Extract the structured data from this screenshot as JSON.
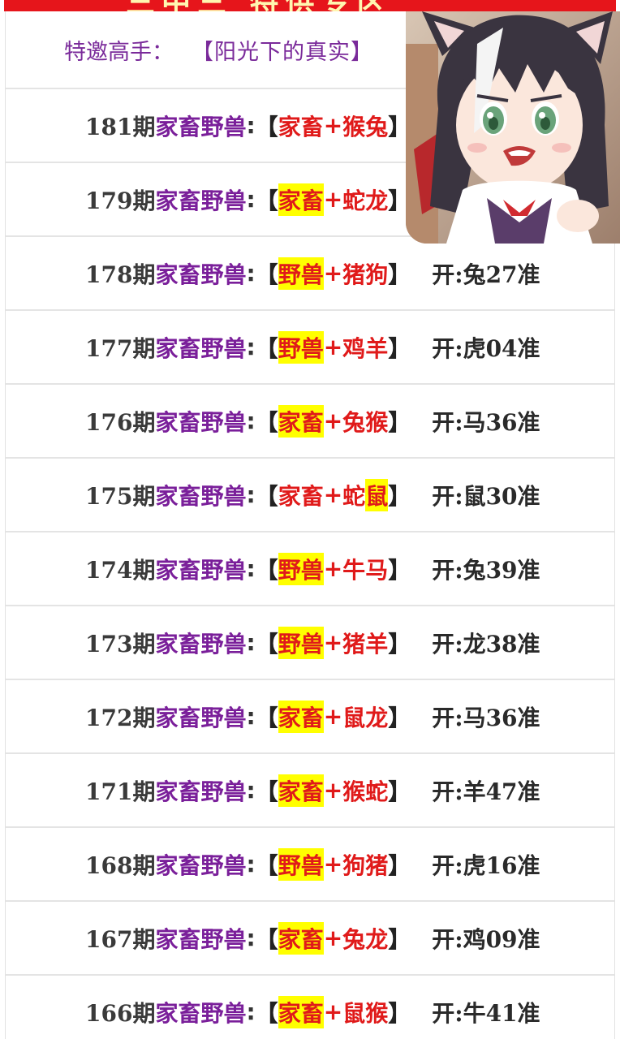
{
  "header": {
    "banner_text": "三中三    特供专区"
  },
  "guest": {
    "label": "特邀高手：",
    "name": "【阳光下的真实】"
  },
  "topic_label": "家畜野兽",
  "result_prefix": "开:",
  "result_suffix": "准",
  "rows": [
    {
      "issue": "181期",
      "group": "家畜",
      "group_hl": false,
      "animals": [
        {
          "t": "猴",
          "hl": false
        },
        {
          "t": "兔",
          "hl": false
        }
      ],
      "result": ""
    },
    {
      "issue": "179期",
      "group": "家畜",
      "group_hl": true,
      "animals": [
        {
          "t": "蛇",
          "hl": false
        },
        {
          "t": "龙",
          "hl": false
        }
      ],
      "result": ""
    },
    {
      "issue": "178期",
      "group": "野兽",
      "group_hl": true,
      "animals": [
        {
          "t": "猪",
          "hl": false
        },
        {
          "t": "狗",
          "hl": false
        }
      ],
      "result": "兔27"
    },
    {
      "issue": "177期",
      "group": "野兽",
      "group_hl": true,
      "animals": [
        {
          "t": "鸡",
          "hl": false
        },
        {
          "t": "羊",
          "hl": false
        }
      ],
      "result": "虎04"
    },
    {
      "issue": "176期",
      "group": "家畜",
      "group_hl": true,
      "animals": [
        {
          "t": "兔",
          "hl": false
        },
        {
          "t": "猴",
          "hl": false
        }
      ],
      "result": "马36"
    },
    {
      "issue": "175期",
      "group": "家畜",
      "group_hl": false,
      "animals": [
        {
          "t": "蛇",
          "hl": false
        },
        {
          "t": "鼠",
          "hl": true
        }
      ],
      "result": "鼠30"
    },
    {
      "issue": "174期",
      "group": "野兽",
      "group_hl": true,
      "animals": [
        {
          "t": "牛",
          "hl": false
        },
        {
          "t": "马",
          "hl": false
        }
      ],
      "result": "兔39"
    },
    {
      "issue": "173期",
      "group": "野兽",
      "group_hl": true,
      "animals": [
        {
          "t": "猪",
          "hl": false
        },
        {
          "t": "羊",
          "hl": false
        }
      ],
      "result": "龙38"
    },
    {
      "issue": "172期",
      "group": "家畜",
      "group_hl": true,
      "animals": [
        {
          "t": "鼠",
          "hl": false
        },
        {
          "t": "龙",
          "hl": false
        }
      ],
      "result": "马36"
    },
    {
      "issue": "171期",
      "group": "家畜",
      "group_hl": true,
      "animals": [
        {
          "t": "猴",
          "hl": false
        },
        {
          "t": "蛇",
          "hl": false
        }
      ],
      "result": "羊47"
    },
    {
      "issue": "168期",
      "group": "野兽",
      "group_hl": true,
      "animals": [
        {
          "t": "狗",
          "hl": false
        },
        {
          "t": "猪",
          "hl": false
        }
      ],
      "result": "虎16"
    },
    {
      "issue": "167期",
      "group": "家畜",
      "group_hl": true,
      "animals": [
        {
          "t": "兔",
          "hl": false
        },
        {
          "t": "龙",
          "hl": false
        }
      ],
      "result": "鸡09"
    },
    {
      "issue": "166期",
      "group": "家畜",
      "group_hl": true,
      "animals": [
        {
          "t": "鼠",
          "hl": false
        },
        {
          "t": "猴",
          "hl": false
        }
      ],
      "result": "牛41"
    }
  ],
  "colors": {
    "banner": "#e6151b",
    "topic": "#7a1f9a",
    "highlight_bg": "#ffff00",
    "highlight_text": "#e01a1a"
  },
  "avatar": {
    "icon": "anime-girl-avatar-sticker"
  }
}
